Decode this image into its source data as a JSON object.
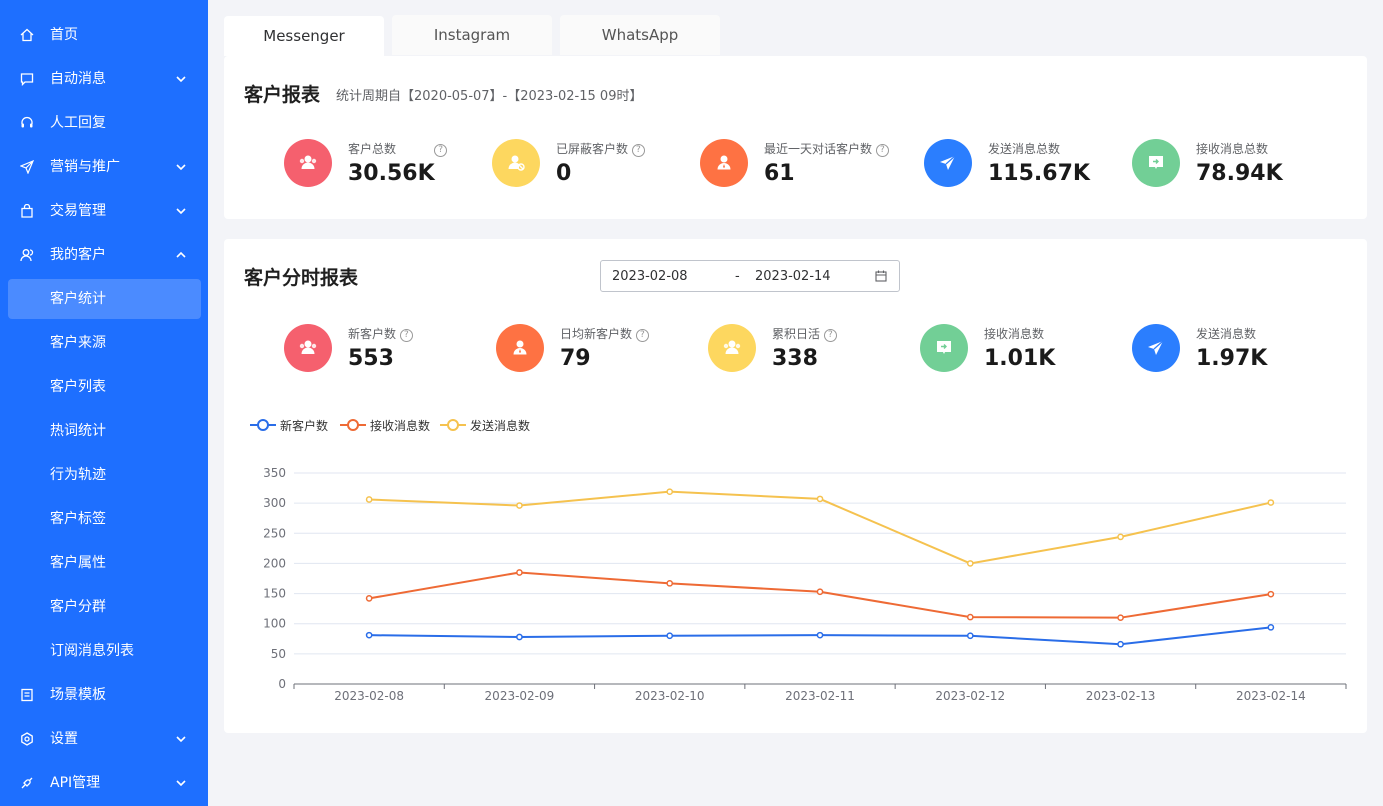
{
  "sidebar": {
    "items": [
      {
        "label": "首页",
        "icon": "home-icon",
        "chevron": ""
      },
      {
        "label": "自动消息",
        "icon": "message-icon",
        "chevron": "down"
      },
      {
        "label": "人工回复",
        "icon": "headset-icon",
        "chevron": ""
      },
      {
        "label": "营销与推广",
        "icon": "send-icon",
        "chevron": "down"
      },
      {
        "label": "交易管理",
        "icon": "bag-icon",
        "chevron": "down"
      },
      {
        "label": "我的客户",
        "icon": "user-icon",
        "chevron": "up"
      }
    ],
    "sub_items": [
      "客户统计",
      "客户来源",
      "客户列表",
      "热词统计",
      "行为轨迹",
      "客户标签",
      "客户属性",
      "客户分群",
      "订阅消息列表"
    ],
    "bottom_items": [
      {
        "label": "场景模板",
        "icon": "template-icon",
        "chevron": ""
      },
      {
        "label": "设置",
        "icon": "settings-icon",
        "chevron": "down"
      },
      {
        "label": "API管理",
        "icon": "api-icon",
        "chevron": "down"
      }
    ],
    "active_sub": "客户统计"
  },
  "tabs": [
    "Messenger",
    "Instagram",
    "WhatsApp"
  ],
  "active_tab": "Messenger",
  "report": {
    "title": "客户报表",
    "period": "统计周期自【2020-05-07】-【2023-02-15 09时】",
    "stats": [
      {
        "label": "客户总数",
        "value": "30.56K",
        "color": "#f5606e",
        "icon": "users-icon",
        "help": true
      },
      {
        "label": "已屏蔽客户数",
        "value": "0",
        "color": "#fdd75f",
        "icon": "blocked-user-icon",
        "help": true
      },
      {
        "label": "最近一天对话客户数",
        "value": "61",
        "color": "#fe7243",
        "icon": "person-icon",
        "help": true
      },
      {
        "label": "发送消息总数",
        "value": "115.67K",
        "color": "#2b7efe",
        "icon": "paper-plane-icon",
        "help": false
      },
      {
        "label": "接收消息总数",
        "value": "78.94K",
        "color": "#72cf96",
        "icon": "inbox-message-icon",
        "help": false
      }
    ]
  },
  "hourly": {
    "title": "客户分时报表",
    "date_start": "2023-02-08",
    "date_sep": "-",
    "date_end": "2023-02-14",
    "stats": [
      {
        "label": "新客户数",
        "value": "553",
        "color": "#f5606e",
        "icon": "users-icon",
        "help": true
      },
      {
        "label": "日均新客户数",
        "value": "79",
        "color": "#fe7243",
        "icon": "person-icon",
        "help": true
      },
      {
        "label": "累积日活",
        "value": "338",
        "color": "#fdd75f",
        "icon": "users-icon",
        "help": true
      },
      {
        "label": "接收消息数",
        "value": "1.01K",
        "color": "#72cf96",
        "icon": "inbox-message-icon",
        "help": false
      },
      {
        "label": "发送消息数",
        "value": "1.97K",
        "color": "#2b7efe",
        "icon": "paper-plane-icon",
        "help": false
      }
    ]
  },
  "chart_data": {
    "type": "line",
    "categories": [
      "2023-02-08",
      "2023-02-09",
      "2023-02-10",
      "2023-02-11",
      "2023-02-12",
      "2023-02-13",
      "2023-02-14"
    ],
    "series": [
      {
        "name": "新客户数",
        "color": "#2a6de8",
        "values": [
          81,
          78,
          80,
          81,
          80,
          66,
          94
        ]
      },
      {
        "name": "接收消息数",
        "color": "#ee6a35",
        "values": [
          142,
          185,
          167,
          153,
          111,
          110,
          149
        ]
      },
      {
        "name": "发送消息数",
        "color": "#f5c24f",
        "values": [
          306,
          296,
          319,
          307,
          200,
          244,
          301
        ]
      }
    ],
    "ylim": [
      0,
      350
    ],
    "yticks": [
      0,
      50,
      100,
      150,
      200,
      250,
      300,
      350
    ],
    "grid": true,
    "legend": "top-left"
  }
}
